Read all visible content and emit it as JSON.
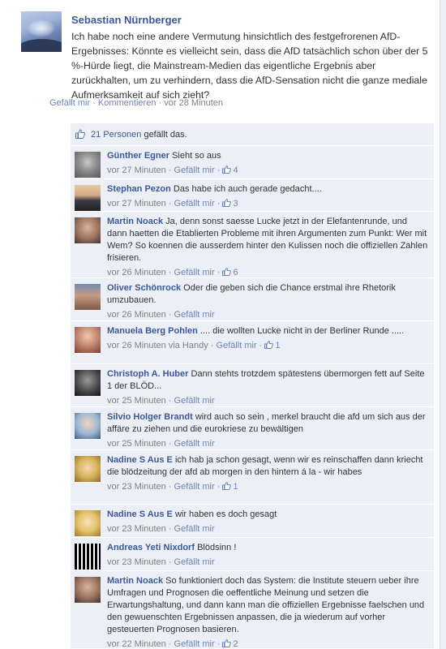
{
  "post": {
    "author": "Sebastian Nürnberger",
    "text": "Ich habe noch eine andere Vermutung hinsichtlich des festgefrorenen AfD-Ergebnisses: Könnte es vielleicht sein, dass die AfD tatsächlich schon über der 5 %-Hürde liegt, die Mainstream-Medien das eigentliche Ergebnis aber zurückhalten, um zu verhindern, dass die AfD-Sensation nicht die ganze mediale Aufmerksamkeit auf sich zieht?",
    "like_label": "Gefällt mir",
    "separator": " · ",
    "comment_label": "Kommentieren",
    "time": "vor 28 Minuten"
  },
  "likes": {
    "count_link": "21 Personen",
    "suffix": " gefällt das."
  },
  "comments": [
    {
      "author": "Günther Egner",
      "text": "Sieht so aus",
      "time": "vor 27 Minuten",
      "like": "Gefällt mir",
      "likes": "4"
    },
    {
      "author": "Stephan Pezon",
      "text": "Das habe ich auch gerade gedacht....",
      "time": "vor 27 Minuten",
      "like": "Gefällt mir",
      "likes": "3"
    },
    {
      "author": "Martin Noack",
      "text": "Ja, denn sonst saesse Lucke jetzt in der Elefantenrunde, und dann haetten die Etablierten Probleme mit ihren Argumenten zum Punkt: Wer mit Wem? So koennen die ausserdem hinter den Kulissen noch die offiziellen Zahlen frisieren.",
      "time": "vor 26 Minuten",
      "like": "Gefällt mir",
      "likes": "6"
    },
    {
      "author": "Oliver Schönrock",
      "text": "Oder die geben sich die Chance erstmal ihre Rhetorik umzubauen.",
      "time": "vor 26 Minuten",
      "like": "Gefällt mir",
      "likes": ""
    },
    {
      "author": "Manuela Berg Pohlen",
      "text": ".... die wollten Lucke nicht in der Berliner Runde .....",
      "time": "vor 26 Minuten via Handy",
      "like": "Gefällt mir",
      "likes": "1"
    },
    {
      "author": "Christoph A. Huber",
      "text": "Dann stehts trotzdem spätestens übermorgen fett auf Seite 1 der BLÖD...",
      "time": "vor 25 Minuten",
      "like": "Gefällt mir",
      "likes": ""
    },
    {
      "author": "Silvio Holger Brandt",
      "text": "wird auch so sein , merkel braucht die afd um sich aus der affäre zu ziehen und die eurokriese zu bewältigen",
      "time": "vor 25 Minuten",
      "like": "Gefällt mir",
      "likes": ""
    },
    {
      "author": "Nadine S Aus E",
      "text": "ich hab ja schon gesagt, wenn wir es reinschaffen dann kriecht die blödzeitung der afd ab morgen in den hintern á la - wir habes",
      "time": "vor 23 Minuten",
      "like": "Gefällt mir",
      "likes": "1"
    },
    {
      "author": "Nadine S Aus E",
      "text": "wir haben es doch gesagt",
      "time": "vor 23 Minuten",
      "like": "Gefällt mir",
      "likes": ""
    },
    {
      "author": "Andreas Yeti Nixdorf",
      "text": "Blödsinn !",
      "time": "vor 23 Minuten",
      "like": "Gefällt mir",
      "likes": ""
    },
    {
      "author": "Martin Noack",
      "text": "So funktioniert doch das System: die Institute steuern ueber ihre Umfragen und Prognosen die oeffentliche Meinung und setzen die Erwartungshaltung, und dann kann man die offiziellen Ergebnisse faelschen und den gewuenschten Ergebnissen anpassen, die ja wiederum auf vorher gesteuerten Prognosen basieren.",
      "time": "vor 22 Minuten",
      "like": "Gefällt mir",
      "likes": "2"
    }
  ],
  "colors": {
    "link": "#3b5998",
    "subtle_link": "#6d84b4",
    "comment_bg": "#eceff6",
    "meta": "#808080"
  }
}
